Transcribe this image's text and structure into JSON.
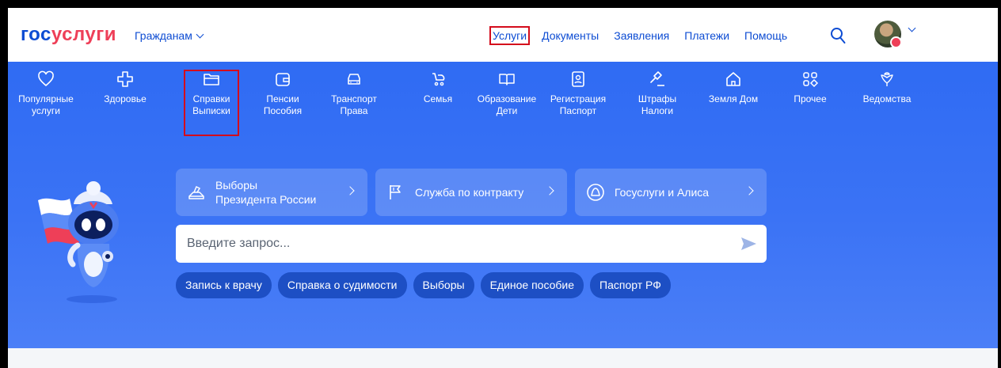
{
  "header": {
    "logo_part1": "гос",
    "logo_part2": "услуги",
    "audience": "Гражданам",
    "nav": [
      "Услуги",
      "Документы",
      "Заявления",
      "Платежи",
      "Помощь"
    ],
    "highlighted_nav": "Услуги"
  },
  "categories": [
    {
      "line1": "Популярные",
      "line2": "услуги",
      "icon": "heart-icon"
    },
    {
      "line1": "Здоровье",
      "line2": "",
      "icon": "medical-cross-icon"
    },
    {
      "line1": "Справки",
      "line2": "Выписки",
      "icon": "folder-icon"
    },
    {
      "line1": "Пенсии",
      "line2": "Пособия",
      "icon": "wallet-icon"
    },
    {
      "line1": "Транспорт",
      "line2": "Права",
      "icon": "car-icon"
    },
    {
      "line1": "Семья",
      "line2": "",
      "icon": "stroller-icon"
    },
    {
      "line1": "Образование",
      "line2": "Дети",
      "icon": "book-icon"
    },
    {
      "line1": "Регистрация",
      "line2": "Паспорт",
      "icon": "passport-icon"
    },
    {
      "line1": "Штрафы",
      "line2": "Налоги",
      "icon": "gavel-icon"
    },
    {
      "line1": "Земля Дом",
      "line2": "",
      "icon": "house-icon"
    },
    {
      "line1": "Прочее",
      "line2": "",
      "icon": "grid-icon"
    },
    {
      "line1": "Ведомства",
      "line2": "",
      "icon": "emblem-icon"
    }
  ],
  "highlighted_category": "Справки Выписки",
  "promos": [
    {
      "line1": "Выборы",
      "line2": "Президента России",
      "icon": "ballot-icon"
    },
    {
      "line1": "Служба по контракту",
      "line2": "",
      "icon": "flag-icon"
    },
    {
      "line1": "Госуслуги и Алиса",
      "line2": "",
      "icon": "alice-icon"
    }
  ],
  "search": {
    "placeholder": "Введите запрос..."
  },
  "chips": [
    "Запись к врачу",
    "Справка о судимости",
    "Выборы",
    "Единое пособие",
    "Паспорт РФ"
  ],
  "colors": {
    "brand_blue": "#0d4cd3",
    "brand_red": "#ee3f58",
    "hero_blue": "#3b73f5",
    "chip": "#1d4fc4",
    "highlight": "#d40c1c"
  }
}
